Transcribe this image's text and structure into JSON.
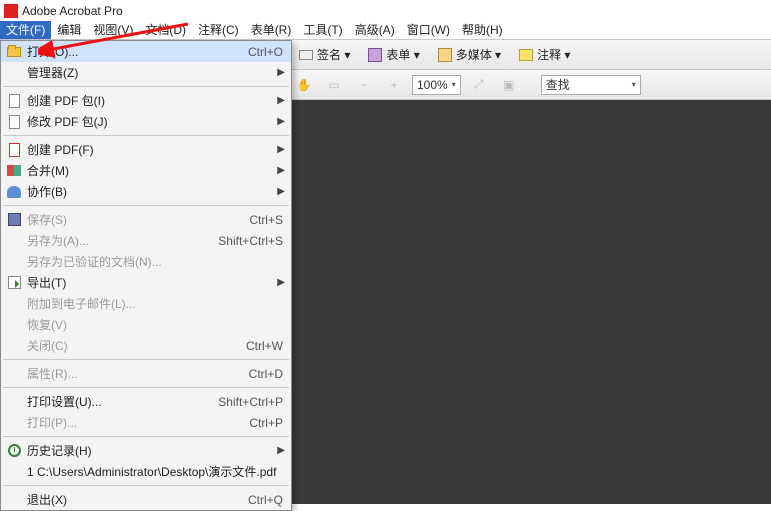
{
  "app": {
    "title": "Adobe Acrobat Pro"
  },
  "menubar": [
    {
      "label": "文件(F)",
      "active": true
    },
    {
      "label": "编辑",
      "active": false
    },
    {
      "label": "视图(V)",
      "active": false
    },
    {
      "label": "文档(D)",
      "active": false
    },
    {
      "label": "注释(C)",
      "active": false
    },
    {
      "label": "表单(R)",
      "active": false
    },
    {
      "label": "工具(T)",
      "active": false
    },
    {
      "label": "高级(A)",
      "active": false
    },
    {
      "label": "窗口(W)",
      "active": false
    },
    {
      "label": "帮助(H)",
      "active": false
    }
  ],
  "toolbar1": {
    "sign_label": "签名 ▾",
    "form_label": "表单 ▾",
    "media_label": "多媒体 ▾",
    "comment_label": "注释 ▾"
  },
  "toolbar2": {
    "zoom_value": "100%",
    "search_placeholder": "查找"
  },
  "file_menu": [
    {
      "type": "item",
      "icon": "folder",
      "label": "打开(O)...",
      "accel": "Ctrl+O",
      "hover": true
    },
    {
      "type": "item",
      "icon": "",
      "label": "管理器(Z)",
      "submenu": true
    },
    {
      "type": "sep"
    },
    {
      "type": "item",
      "icon": "page",
      "label": "创建 PDF 包(I)",
      "submenu": true
    },
    {
      "type": "item",
      "icon": "page",
      "label": "修改 PDF 包(J)",
      "submenu": true
    },
    {
      "type": "sep"
    },
    {
      "type": "item",
      "icon": "pdf",
      "label": "创建 PDF(F)",
      "submenu": true
    },
    {
      "type": "item",
      "icon": "merge",
      "label": "合并(M)",
      "submenu": true
    },
    {
      "type": "item",
      "icon": "people",
      "label": "协作(B)",
      "submenu": true
    },
    {
      "type": "sep"
    },
    {
      "type": "item",
      "icon": "save",
      "label": "保存(S)",
      "accel": "Ctrl+S",
      "disabled": true
    },
    {
      "type": "item",
      "icon": "",
      "label": "另存为(A)...",
      "accel": "Shift+Ctrl+S",
      "disabled": true
    },
    {
      "type": "item",
      "icon": "",
      "label": "另存为已验证的文档(N)...",
      "disabled": true
    },
    {
      "type": "item",
      "icon": "export",
      "label": "导出(T)",
      "submenu": true
    },
    {
      "type": "item",
      "icon": "",
      "label": "附加到电子邮件(L)...",
      "disabled": true
    },
    {
      "type": "item",
      "icon": "",
      "label": "恢复(V)",
      "disabled": true
    },
    {
      "type": "item",
      "icon": "",
      "label": "关闭(C)",
      "accel": "Ctrl+W",
      "disabled": true
    },
    {
      "type": "sep"
    },
    {
      "type": "item",
      "icon": "",
      "label": "属性(R)...",
      "accel": "Ctrl+D",
      "disabled": true
    },
    {
      "type": "sep"
    },
    {
      "type": "item",
      "icon": "",
      "label": "打印设置(U)...",
      "accel": "Shift+Ctrl+P"
    },
    {
      "type": "item",
      "icon": "",
      "label": "打印(P)...",
      "accel": "Ctrl+P",
      "disabled": true
    },
    {
      "type": "sep"
    },
    {
      "type": "item",
      "icon": "history",
      "label": "历史记录(H)",
      "submenu": true
    },
    {
      "type": "item",
      "icon": "",
      "label": "1 C:\\Users\\Administrator\\Desktop\\演示文件.pdf"
    },
    {
      "type": "sep"
    },
    {
      "type": "item",
      "icon": "",
      "label": "退出(X)",
      "accel": "Ctrl+Q"
    }
  ]
}
